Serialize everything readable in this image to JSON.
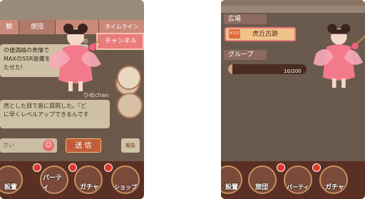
{
  "left_panel": {
    "tabs": [
      "観",
      "旅団",
      "",
      "タイムライン"
    ],
    "channel_button": "チャンネル",
    "messages": [
      {
        "name": "ひめ",
        "lines": [
          "の値満嶋の表情で",
          "MAXのSSR装備を",
          "たせた!"
        ]
      },
      {
        "name": "ひめchan",
        "lines": [
          "然とした目で皆に質問した。『ど",
          "に早くレベルアップできるんです"
        ]
      }
    ],
    "input_placeholder": "さい",
    "send_label": "送 信",
    "report_label": "報告",
    "nav": [
      "設置",
      "パーティ",
      "ガチャ",
      "ショップ"
    ]
  },
  "right_panel": {
    "section_square": "広場",
    "location_tag": "ボスク",
    "location_name": "虎丘古跡",
    "section_group": "グループ",
    "group_progress_label": "10/200",
    "group_progress_value": 0.05,
    "nav": [
      "設置",
      "旅団",
      "パーティ",
      "ガチャ"
    ]
  },
  "colors": {
    "accent_pink": "#ea7c7c",
    "panel_brown": "#6e5a4c",
    "send_red": "#c25c3c"
  }
}
